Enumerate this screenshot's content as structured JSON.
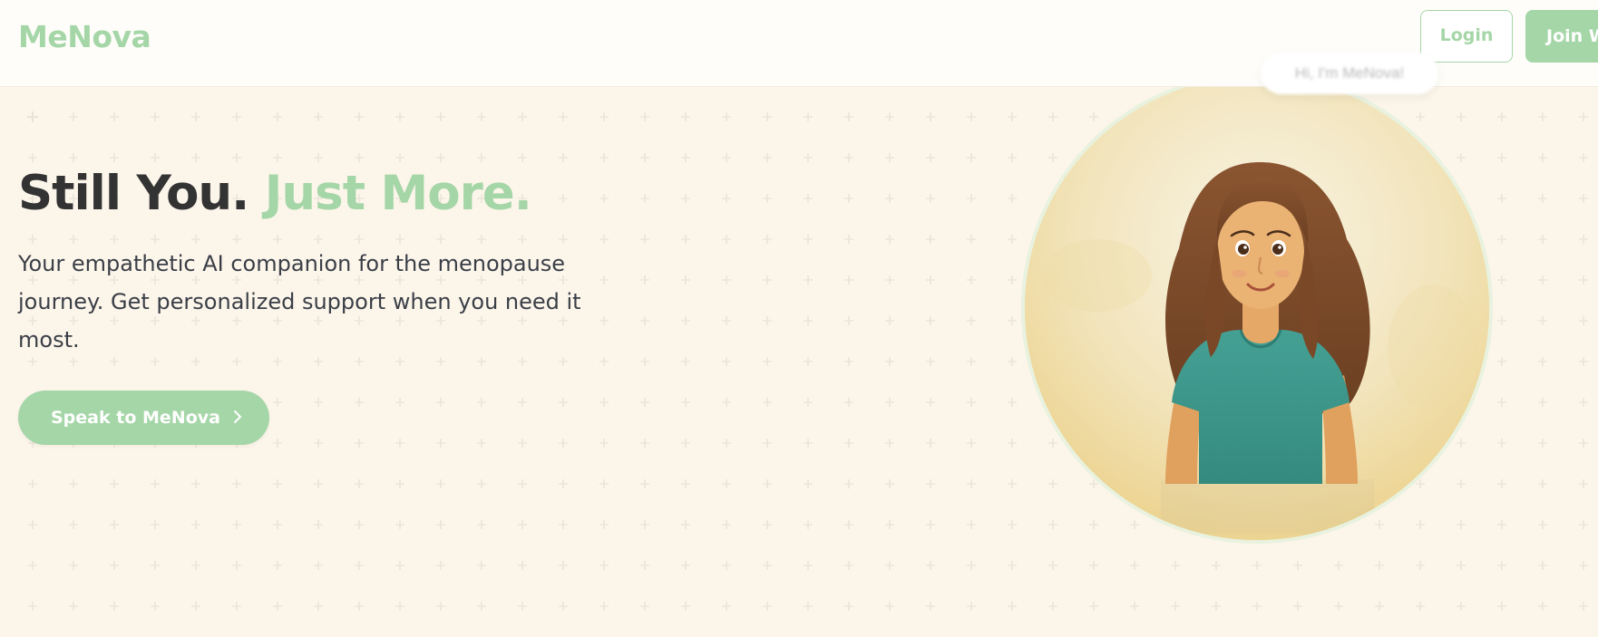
{
  "brand": {
    "name": "MeNova",
    "accent": "#a5d6a7"
  },
  "header": {
    "login_label": "Login",
    "join_label": "Join W"
  },
  "hero": {
    "title_main": "Still You.",
    "title_accent": "Just More.",
    "subtitle": "Your empathetic AI companion for the menopause journey. Get personalized support when you need it most.",
    "cta_label": "Speak to MeNova",
    "cta_icon": "chevron-right-icon"
  },
  "avatar": {
    "speech_text": "Hi, I'm MeNova!"
  },
  "colors": {
    "background": "#fcf5ea",
    "header_bg": "#fefdf9",
    "text_dark": "#333333",
    "shirt": "#3f9a8e",
    "hair": "#7a4a2b"
  }
}
